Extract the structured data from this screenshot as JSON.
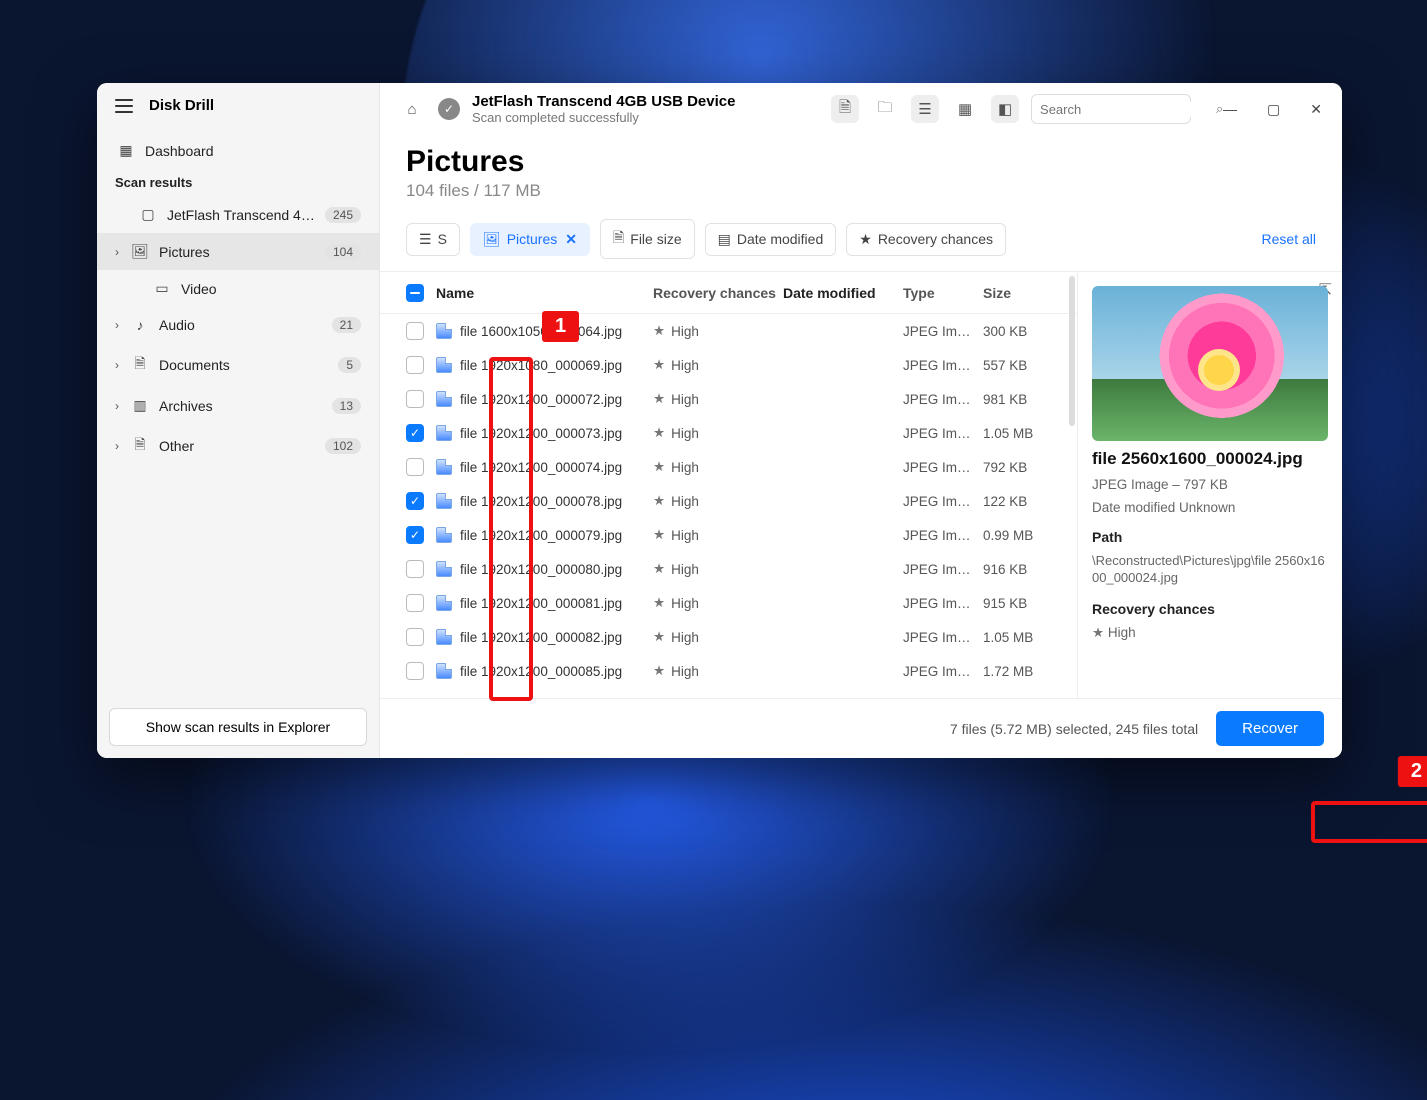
{
  "app_title": "Disk Drill",
  "sidebar": {
    "dashboard": "Dashboard",
    "section": "Scan results",
    "device": {
      "label": "JetFlash Transcend 4GB...",
      "count": "245"
    },
    "categories": [
      {
        "label": "Pictures",
        "count": "104",
        "active": true,
        "expandable": true,
        "icon": "image"
      },
      {
        "label": "Video",
        "count": "",
        "expandable": false,
        "indent": true,
        "icon": "video"
      },
      {
        "label": "Audio",
        "count": "21",
        "expandable": true,
        "icon": "audio"
      },
      {
        "label": "Documents",
        "count": "5",
        "expandable": true,
        "icon": "document"
      },
      {
        "label": "Archives",
        "count": "13",
        "expandable": true,
        "icon": "archive"
      },
      {
        "label": "Other",
        "count": "102",
        "expandable": true,
        "icon": "other"
      }
    ],
    "bottom_btn": "Show scan results in Explorer"
  },
  "titlebar": {
    "device_name": "JetFlash Transcend 4GB USB Device",
    "status": "Scan completed successfully",
    "search_placeholder": "Search"
  },
  "heading": {
    "title": "Pictures",
    "sub": "104 files / 117 MB"
  },
  "filters": {
    "s_prefix": "S",
    "pictures": "Pictures",
    "file_size": "File size",
    "date_modified": "Date modified",
    "recovery": "Recovery chances",
    "reset": "Reset all"
  },
  "columns": {
    "name": "Name",
    "rc": "Recovery chances",
    "dm": "Date modified",
    "type": "Type",
    "size": "Size"
  },
  "rc_label": "High",
  "type_label": "JPEG Im…",
  "files": [
    {
      "name": "file 1600x1050_000064.jpg",
      "size": "300 KB",
      "checked": false
    },
    {
      "name": "file 1920x1080_000069.jpg",
      "size": "557 KB",
      "checked": false
    },
    {
      "name": "file 1920x1200_000072.jpg",
      "size": "981 KB",
      "checked": false
    },
    {
      "name": "file 1920x1200_000073.jpg",
      "size": "1.05 MB",
      "checked": true
    },
    {
      "name": "file 1920x1200_000074.jpg",
      "size": "792 KB",
      "checked": false
    },
    {
      "name": "file 1920x1200_000078.jpg",
      "size": "122 KB",
      "checked": true
    },
    {
      "name": "file 1920x1200_000079.jpg",
      "size": "0.99 MB",
      "checked": true
    },
    {
      "name": "file 1920x1200_000080.jpg",
      "size": "916 KB",
      "checked": false
    },
    {
      "name": "file 1920x1200_000081.jpg",
      "size": "915 KB",
      "checked": false
    },
    {
      "name": "file 1920x1200_000082.jpg",
      "size": "1.05 MB",
      "checked": false
    },
    {
      "name": "file 1920x1200_000085.jpg",
      "size": "1.72 MB",
      "checked": false
    }
  ],
  "preview": {
    "name": "file 2560x1600_000024.jpg",
    "meta": "JPEG Image – 797 KB",
    "date": "Date modified Unknown",
    "path_label": "Path",
    "path": "\\Reconstructed\\Pictures\\jpg\\file 2560x1600_000024.jpg",
    "rc_label": "Recovery chances",
    "rc_value": "High"
  },
  "footer": {
    "status": "7 files (5.72 MB) selected, 245 files total",
    "recover": "Recover"
  },
  "annotations": {
    "one": "1",
    "two": "2"
  }
}
